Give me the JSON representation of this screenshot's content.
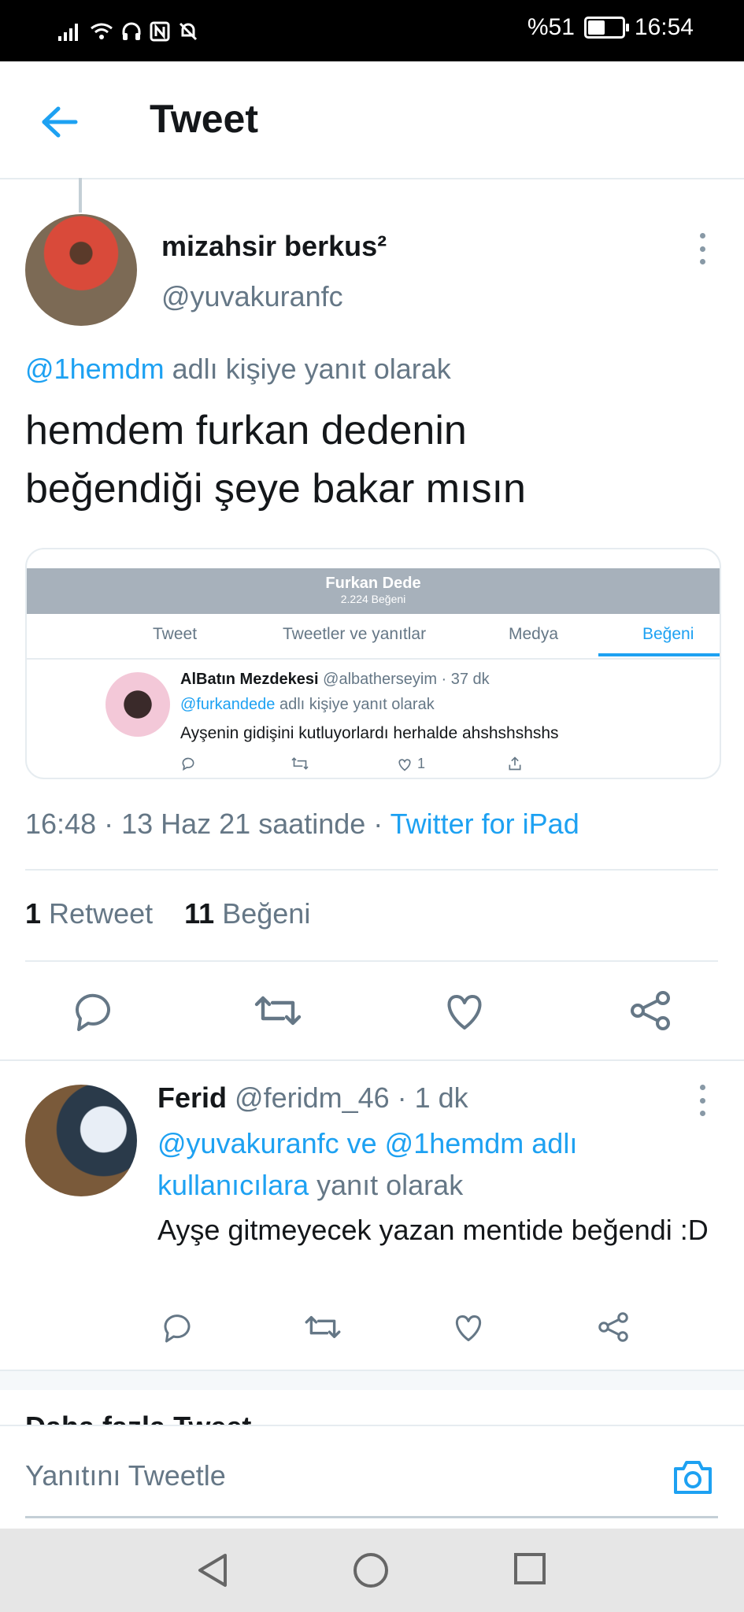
{
  "status_bar": {
    "battery": "%51",
    "time": "16:54",
    "battery_level": 0.51
  },
  "header": {
    "title": "Tweet"
  },
  "tweet": {
    "name": "mizahsir berkus²",
    "handle": "@yuvakuranfc",
    "reply_to_handle": "@1hemdm",
    "reply_to_suffix": " adlı kişiye yanıt olarak",
    "text_line1": "hemdem furkan dedenin",
    "text_line2": "beğendiği şeye bakar mısın",
    "embed": {
      "profile_name": "Furkan Dede",
      "profile_likes": "2.224 Beğeni",
      "tabs": [
        "Tweet",
        "Tweetler ve yanıtlar",
        "Medya",
        "Beğeni"
      ],
      "liked_user_name": "AlBatın Mezdekesi",
      "liked_user_handle": "@albatherseyim · 37 dk",
      "liked_reply_handle": "@furkandede",
      "liked_reply_suffix": " adlı kişiye yanıt olarak",
      "liked_text": "Ayşenin gidişini kutluyorlardı herhalde ahshshshshs",
      "liked_like_count": "1"
    },
    "time": "16:48 · 13 Haz 21 saatinde · ",
    "source": "Twitter for iPad",
    "retweet_count": "1",
    "retweet_label": "Retweet",
    "like_count": "11",
    "like_label": "Beğeni"
  },
  "reply": {
    "name": "Ferid",
    "handle_time": " @feridm_46 · 1 dk",
    "reply_to_link": "@yuvakuranfc ve @1hemdm adlı kullanıcılara",
    "reply_to_suffix": " yanıt olarak",
    "text": "Ayşe gitmeyecek yazan mentide beğendi :D"
  },
  "peek_text": "Daha fazla Tweet",
  "composer": {
    "placeholder": "Yanıtını Tweetle"
  },
  "colors": {
    "accent": "#1da1f2",
    "secondary_text": "#657786"
  }
}
